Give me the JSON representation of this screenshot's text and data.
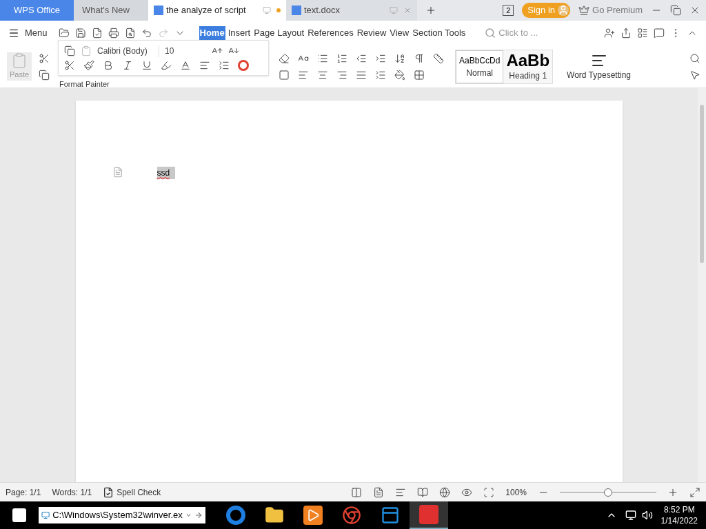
{
  "tabs": [
    {
      "label": "WPS Office",
      "kind": "home"
    },
    {
      "label": "What's New",
      "kind": "plain"
    },
    {
      "label": "the analyze of script",
      "kind": "doc",
      "selected": true,
      "unsaved": true
    },
    {
      "label": "text.docx",
      "kind": "doc",
      "selected": false,
      "unsaved": false
    }
  ],
  "window_count": "2",
  "sign_in": "Sign in",
  "premium": "Go Premium",
  "menu": "Menu",
  "ribbon_tabs": [
    {
      "label": "Home",
      "selected": true
    },
    {
      "label": "Insert",
      "selected": false
    },
    {
      "label": "Page Layout",
      "selected": false
    },
    {
      "label": "References",
      "selected": false
    },
    {
      "label": "Review",
      "selected": false
    },
    {
      "label": "View",
      "selected": false
    },
    {
      "label": "Section Tools",
      "selected": false
    }
  ],
  "search": {
    "placeholder": "Click to ..."
  },
  "clipboard": {
    "paste": "Paste",
    "format_painter": "Format Painter"
  },
  "mini_toolbar": {
    "font": "Calibri (Body)",
    "size": "10"
  },
  "styles": [
    {
      "preview": "AaBbCcDd",
      "name": "Normal",
      "selected": true,
      "kind": "small"
    },
    {
      "preview": "AaBb",
      "name": "Heading 1",
      "selected": false,
      "kind": "big"
    }
  ],
  "typesetting": "Word Typesetting",
  "document": {
    "text": "ssd",
    "selected": true
  },
  "status_bar": {
    "page": "Page: 1/1",
    "words": "Words: 1/1",
    "spell_check": "Spell Check",
    "zoom": "100%",
    "level": 0.5
  },
  "taskbar": {
    "address": "C:\\Windows\\System32\\winver.ex",
    "apps": [
      {
        "kind": "edge",
        "selected": false
      },
      {
        "kind": "folder",
        "selected": false
      },
      {
        "kind": "player",
        "selected": false
      },
      {
        "kind": "chrome",
        "selected": false
      },
      {
        "kind": "panel",
        "selected": false
      },
      {
        "kind": "wps",
        "selected": true
      }
    ],
    "time": "8:52 PM",
    "date": "1/14/2022"
  }
}
